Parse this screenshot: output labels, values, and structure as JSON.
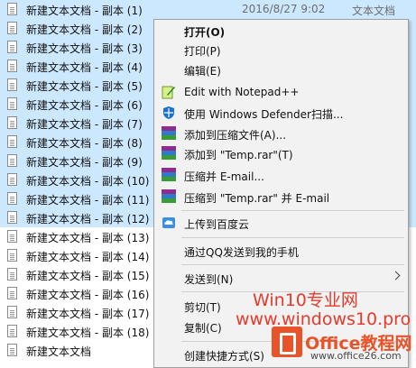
{
  "files": {
    "rows": [
      {
        "name": "新建文本文档 - 副本 (1)",
        "date": "2016/8/27 9:02",
        "type": "文本文档",
        "selected": true
      },
      {
        "name": "新建文本文档 - 副本 (2)",
        "selected": true
      },
      {
        "name": "新建文本文档 - 副本 (3)",
        "selected": true
      },
      {
        "name": "新建文本文档 - 副本 (4)",
        "selected": true
      },
      {
        "name": "新建文本文档 - 副本 (5)",
        "selected": true
      },
      {
        "name": "新建文本文档 - 副本 (6)",
        "selected": true
      },
      {
        "name": "新建文本文档 - 副本 (7)",
        "selected": true
      },
      {
        "name": "新建文本文档 - 副本 (8)",
        "selected": true
      },
      {
        "name": "新建文本文档 - 副本 (9)",
        "selected": true
      },
      {
        "name": "新建文本文档 - 副本 (10)",
        "selected": true
      },
      {
        "name": "新建文本文档 - 副本 (11)",
        "selected": true
      },
      {
        "name": "新建文本文档 - 副本 (12)",
        "selected": true
      },
      {
        "name": "新建文本文档 - 副本 (13)",
        "selected": false
      },
      {
        "name": "新建文本文档 - 副本 (14)",
        "selected": false
      },
      {
        "name": "新建文本文档 - 副本 (15)",
        "selected": false
      },
      {
        "name": "新建文本文档 - 副本 (16)",
        "selected": false
      },
      {
        "name": "新建文本文档 - 副本 (17)",
        "selected": false
      },
      {
        "name": "新建文本文档 - 副本 (18)",
        "selected": false
      },
      {
        "name": "新建文本文档",
        "selected": false
      }
    ]
  },
  "menu": {
    "open": "打开(O)",
    "print": "打印(P)",
    "edit": "编辑(E)",
    "notepadpp": "Edit with Notepad++",
    "defender": "使用 Windows Defender扫描...",
    "add_archive": "添加到压缩文件(A)...",
    "add_temp_rar": "添加到 \"Temp.rar\"(T)",
    "compress_email": "压缩并 E-mail...",
    "compress_temp_email": "压缩到 \"Temp.rar\" 并 E-mail",
    "upload_baidu": "上传到百度云",
    "send_qq": "通过QQ发送到我的手机",
    "send_to": "发送到(N)",
    "cut": "剪切(T)",
    "copy": "复制(C)",
    "create_shortcut": "创建快捷方式(S)"
  },
  "watermark": {
    "line1": "Win10专业网",
    "line2": "www.windows10.pro",
    "brand": "Office教程网",
    "site": "www.office26.com"
  },
  "colors": {
    "selection": "#cce8ff",
    "menu_bg": "#f2f2f2",
    "watermark_red": "#e53a2c",
    "office_orange": "#e8532a"
  }
}
